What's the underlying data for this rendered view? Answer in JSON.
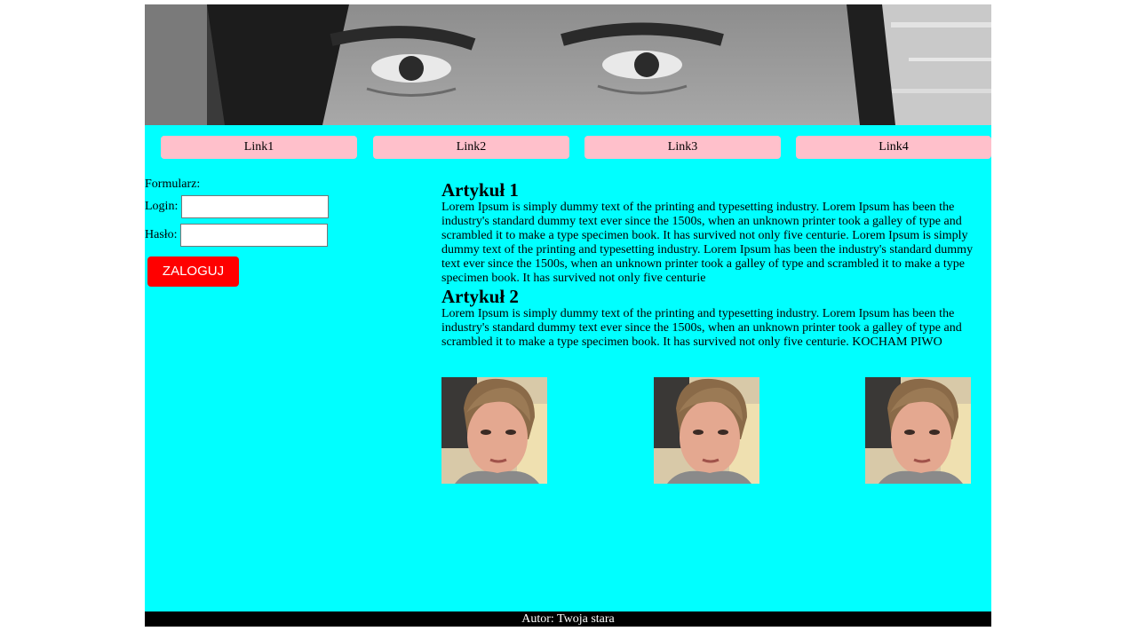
{
  "banner": {
    "image_desc_icon": "banner-face-photo"
  },
  "nav": {
    "links": [
      {
        "label": "Link1"
      },
      {
        "label": "Link2"
      },
      {
        "label": "Link3"
      },
      {
        "label": "Link4"
      }
    ]
  },
  "form": {
    "title": "Formularz:",
    "login_label": "Login:",
    "login_value": "",
    "password_label": "Hasło:",
    "password_value": "",
    "submit_label": "ZALOGUJ"
  },
  "articles": [
    {
      "title": "Artykuł 1",
      "body": "Lorem Ipsum is simply dummy text of the printing and typesetting industry. Lorem Ipsum has been the industry's standard dummy text ever since the 1500s, when an unknown printer took a galley of type and scrambled it to make a type specimen book. It has survived not only five centurie. Lorem Ipsum is simply dummy text of the printing and typesetting industry. Lorem Ipsum has been the industry's standard dummy text ever since the 1500s, when an unknown printer took a galley of type and scrambled it to make a type specimen book. It has survived not only five centurie"
    },
    {
      "title": "Artykuł 2",
      "body": "Lorem Ipsum is simply dummy text of the printing and typesetting industry. Lorem Ipsum has been the industry's standard dummy text ever since the 1500s, when an unknown printer took a galley of type and scrambled it to make a type specimen book. It has survived not only five centurie. KOCHAM PIWO"
    }
  ],
  "photos": [
    {
      "icon": "portrait-photo"
    },
    {
      "icon": "portrait-photo"
    },
    {
      "icon": "portrait-photo"
    }
  ],
  "footer": {
    "text": "Autor: Twoja stara"
  },
  "colors": {
    "page_bg": "#00ffff",
    "nav_link_bg": "#ffc0cb",
    "button_bg": "#ff0000",
    "footer_bg": "#000000"
  }
}
